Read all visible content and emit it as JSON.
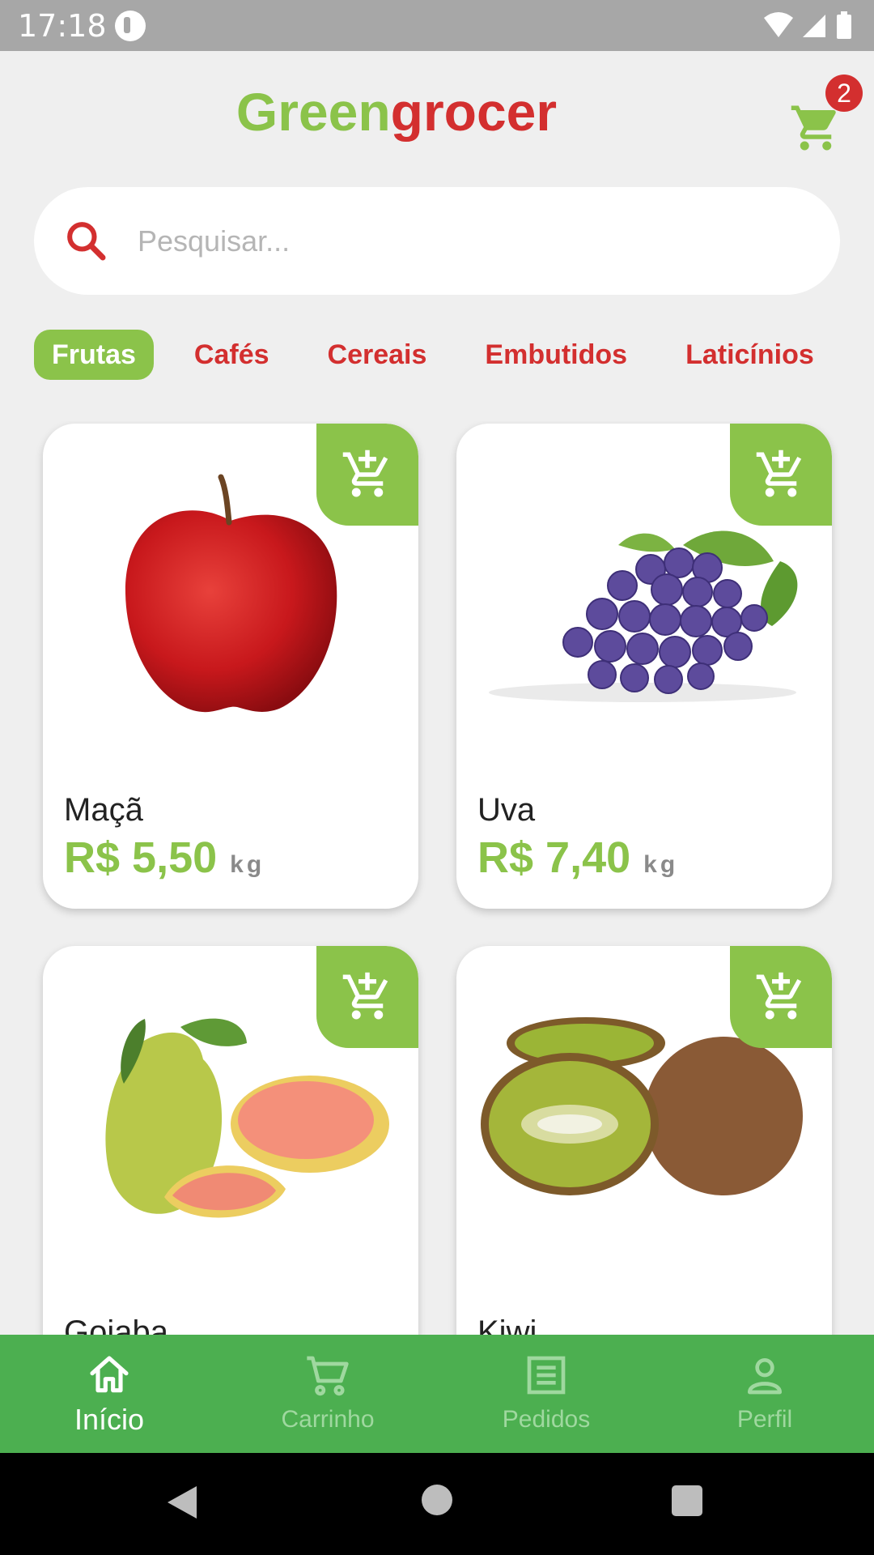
{
  "status": {
    "time": "17:18"
  },
  "header": {
    "brand_part1": "Green",
    "brand_part2": "grocer",
    "cart_count": "2"
  },
  "search": {
    "placeholder": "Pesquisar..."
  },
  "categories": [
    {
      "label": "Frutas",
      "active": true
    },
    {
      "label": "Cafés"
    },
    {
      "label": "Cereais"
    },
    {
      "label": "Embutidos"
    },
    {
      "label": "Laticínios"
    }
  ],
  "products": [
    {
      "name": "Maçã",
      "price": "R$ 5,50",
      "unit": "kg"
    },
    {
      "name": "Uva",
      "price": "R$ 7,40",
      "unit": "kg"
    },
    {
      "name": "Goiaba",
      "price": "",
      "unit": ""
    },
    {
      "name": "Kiwi",
      "price": "",
      "unit": ""
    }
  ],
  "nav": [
    {
      "label": "Início",
      "active": true
    },
    {
      "label": "Carrinho"
    },
    {
      "label": "Pedidos"
    },
    {
      "label": "Perfil"
    }
  ],
  "colors": {
    "primary_green": "#8bc34a",
    "nav_green": "#4caf50",
    "accent_red": "#d32f2f"
  }
}
